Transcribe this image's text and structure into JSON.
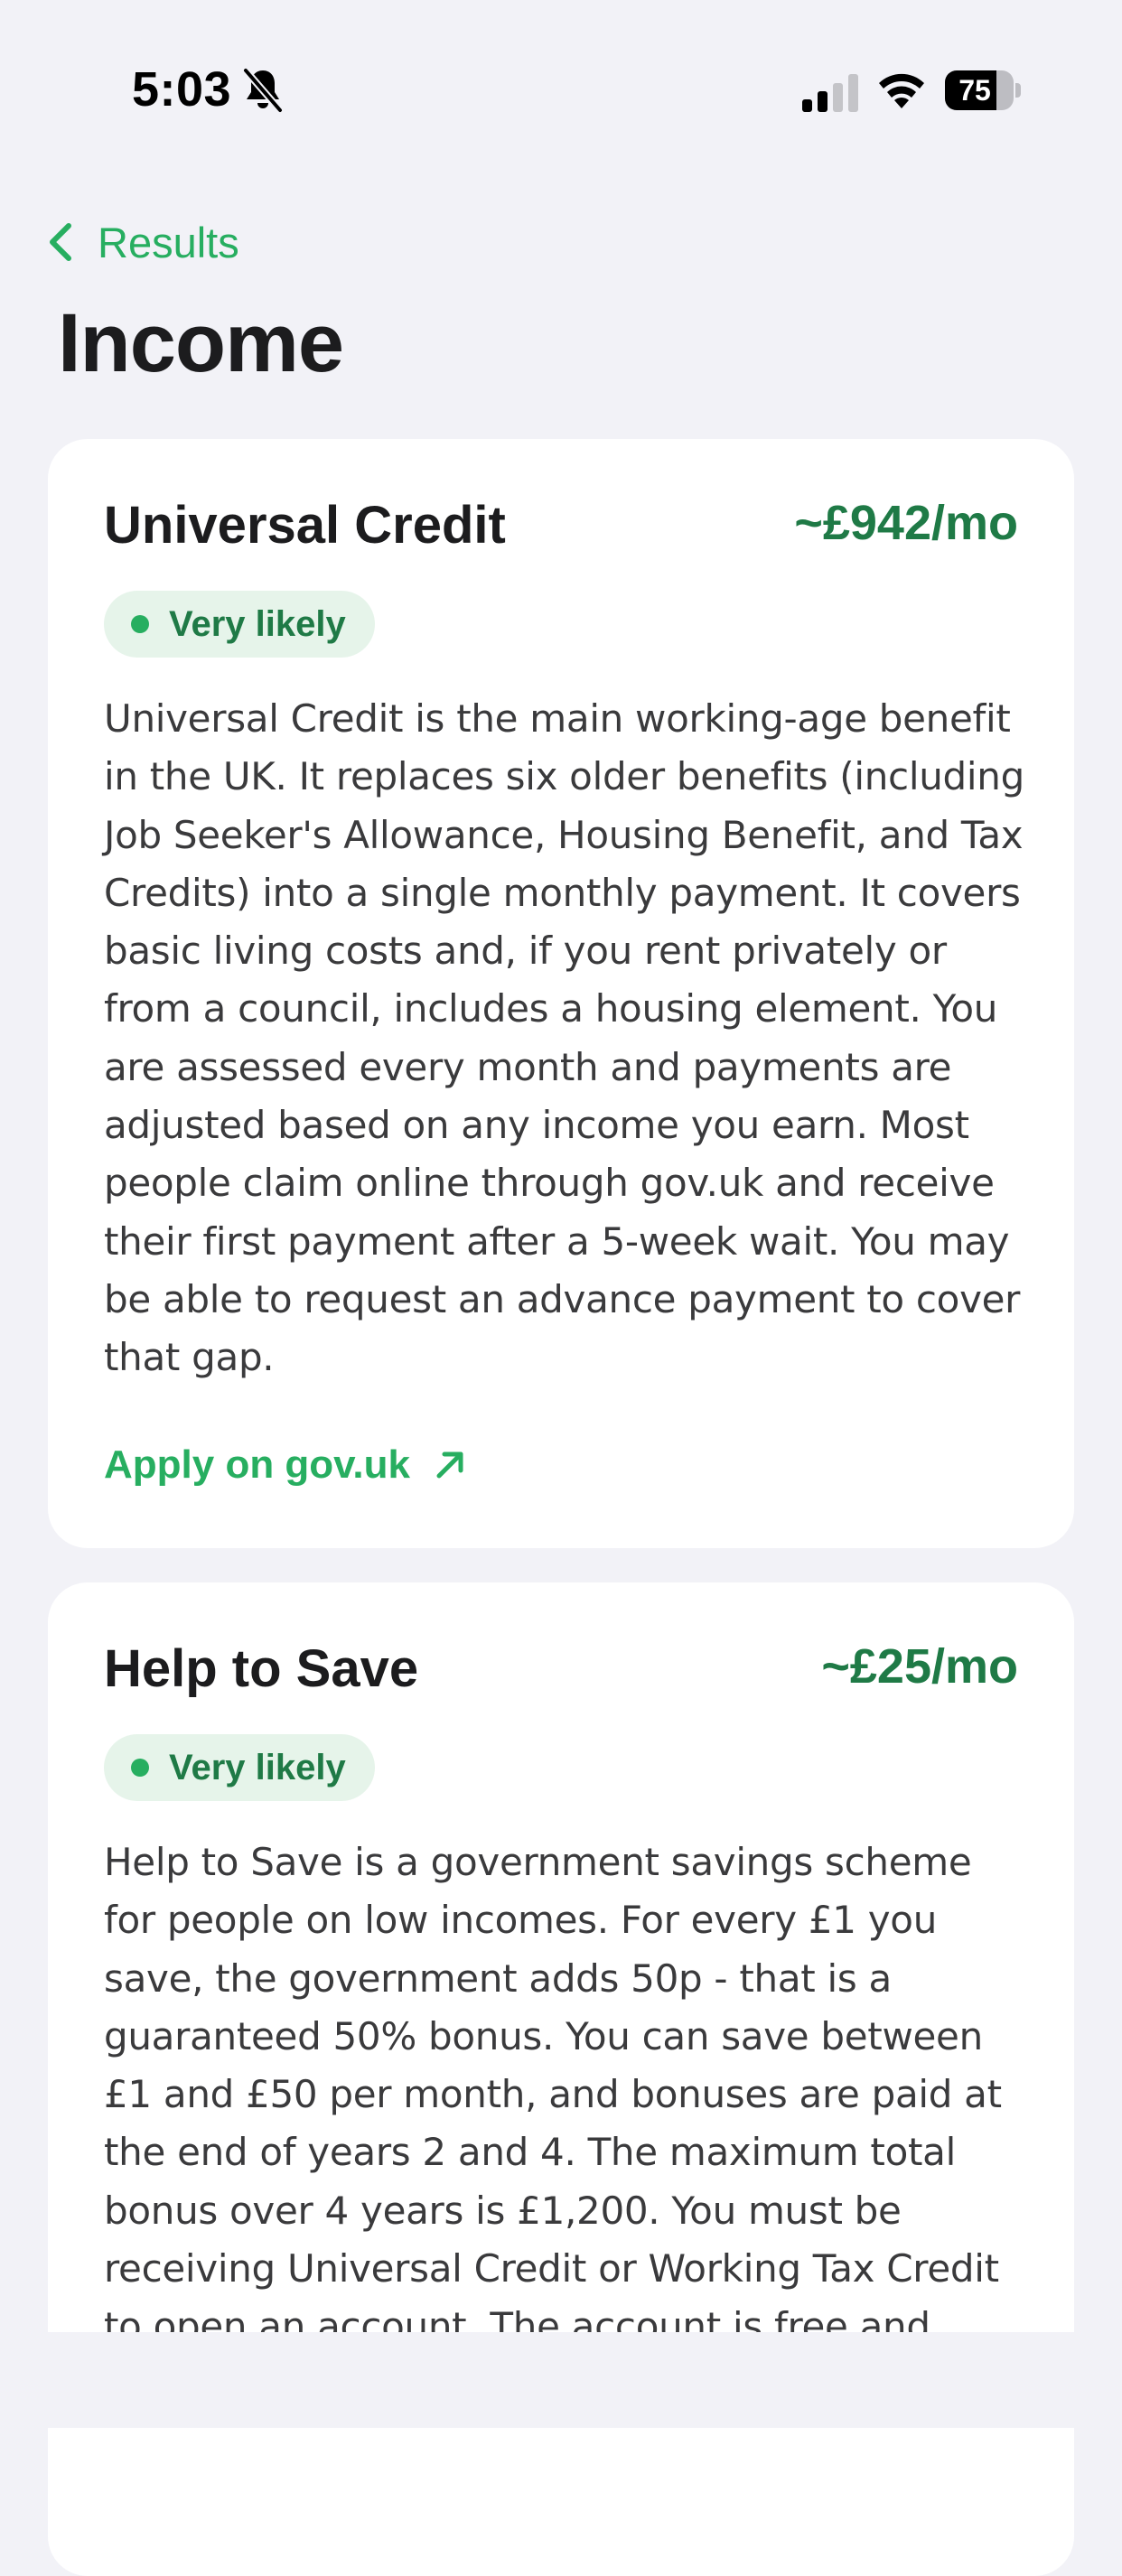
{
  "status_bar": {
    "time": "5:03",
    "battery_level": "75",
    "battery_fraction": 0.75,
    "icons": [
      "bell-slash-icon",
      "cellular-signal-icon",
      "wifi-icon",
      "battery-icon"
    ]
  },
  "nav": {
    "back_label": "Results",
    "back_icon": "chevron-left-icon"
  },
  "page": {
    "title": "Income"
  },
  "colors": {
    "accent": "#27ae60",
    "amount": "#1f7a46",
    "badge_bg": "#e6f4ea",
    "background": "#f2f2f7",
    "card": "#ffffff"
  },
  "cards": [
    {
      "title": "Universal Credit",
      "amount": "~£942/mo",
      "badge": "Very likely",
      "description": "Universal Credit is the main working-age benefit in the UK. It replaces six older benefits (including Job Seeker's Allowance, Housing Benefit, and Tax Credits) into a single monthly payment. It covers basic living costs and, if you rent privately or from a council, includes a housing element. You are assessed every month and payments are adjusted based on any income you earn. Most people claim online through gov.uk and receive their first payment after a 5-week wait. You may be able to request an advance payment to cover that gap.",
      "link_label": "Apply on gov.uk",
      "link_icon": "arrow-up-right-icon"
    },
    {
      "title": "Help to Save",
      "amount": "~£25/mo",
      "badge": "Very likely",
      "description": "Help to Save is a government savings scheme for people on low incomes. For every £1 you save, the government adds 50p - that is a guaranteed 50% bonus. You can save between £1 and £50 per month, and bonuses are paid at the end of years 2 and 4. The maximum total bonus over 4 years is £1,200. You must be receiving Universal Credit or Working Tax Credit to open an account. The account is free and"
    }
  ]
}
